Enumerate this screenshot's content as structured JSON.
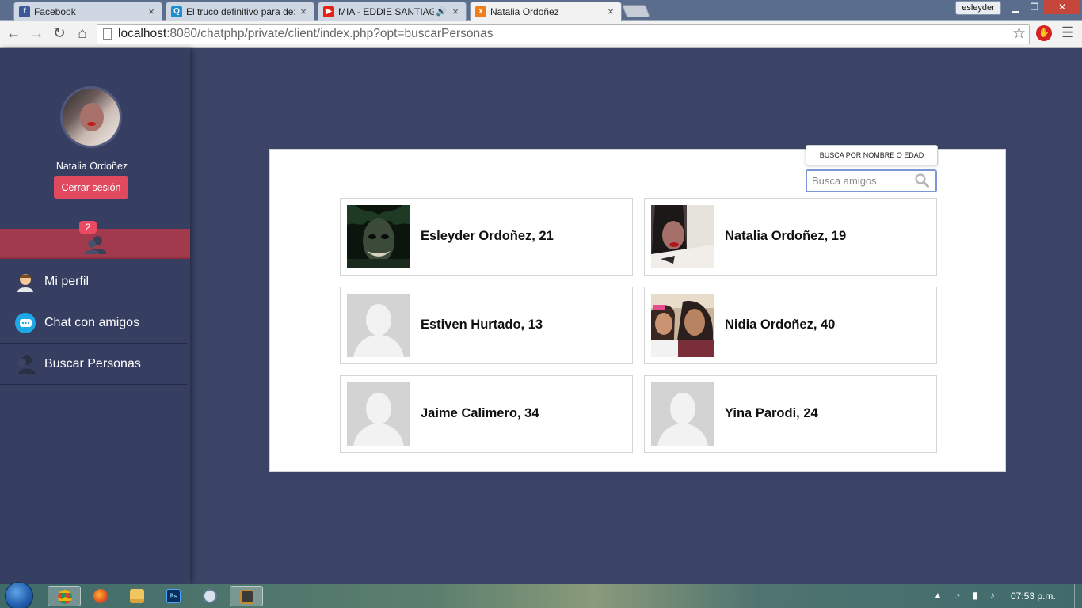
{
  "browser": {
    "tabs": [
      {
        "title": "Facebook",
        "favicon": "facebook-icon",
        "color": "#3b5998"
      },
      {
        "title": "El truco definitivo para de:",
        "favicon": "site-icon",
        "color": "#1d8fd0"
      },
      {
        "title": "MIA - EDDIE SANTIAGO",
        "favicon": "youtube-icon",
        "color": "#e62117",
        "audio": "🔊"
      },
      {
        "title": "Natalia Ordoñez",
        "favicon": "xampp-icon",
        "color": "#f07e1c"
      }
    ],
    "close_glyph": "×",
    "profile_name": "esleyder",
    "url_host": "localhost",
    "url_rest": ":8080/chatphp/private/client/index.php?opt=buscarPersonas"
  },
  "sidebar": {
    "user_name": "Natalia Ordoñez",
    "logout_label": "Cerrar sesión",
    "notification_count": "2",
    "menu": [
      {
        "label": "Mi perfil",
        "icon": "user-profile-icon"
      },
      {
        "label": "Chat con amigos",
        "icon": "chat-bubble-icon"
      },
      {
        "label": "Buscar Personas",
        "icon": "search-people-icon"
      }
    ]
  },
  "search": {
    "tooltip": "BUSCA POR NOMBRE O EDAD",
    "placeholder": "Busca amigos"
  },
  "people": [
    {
      "label": "Esleyder Ordoñez, 21",
      "photo": "joker"
    },
    {
      "label": "Natalia Ordoñez, 19",
      "photo": "selfie"
    },
    {
      "label": "Estiven Hurtado, 13",
      "photo": "placeholder"
    },
    {
      "label": "Nidia Ordoñez, 40",
      "photo": "family"
    },
    {
      "label": "Jaime Calimero, 34",
      "photo": "placeholder"
    },
    {
      "label": "Yina Parodi, 24",
      "photo": "placeholder"
    }
  ],
  "taskbar": {
    "time": "07:53 p.m."
  },
  "colors": {
    "page_bg": "#3b4467",
    "sidebar_bg": "#363e61",
    "accent_red": "#e14a5e",
    "notif_bar": "#a23a4d"
  }
}
